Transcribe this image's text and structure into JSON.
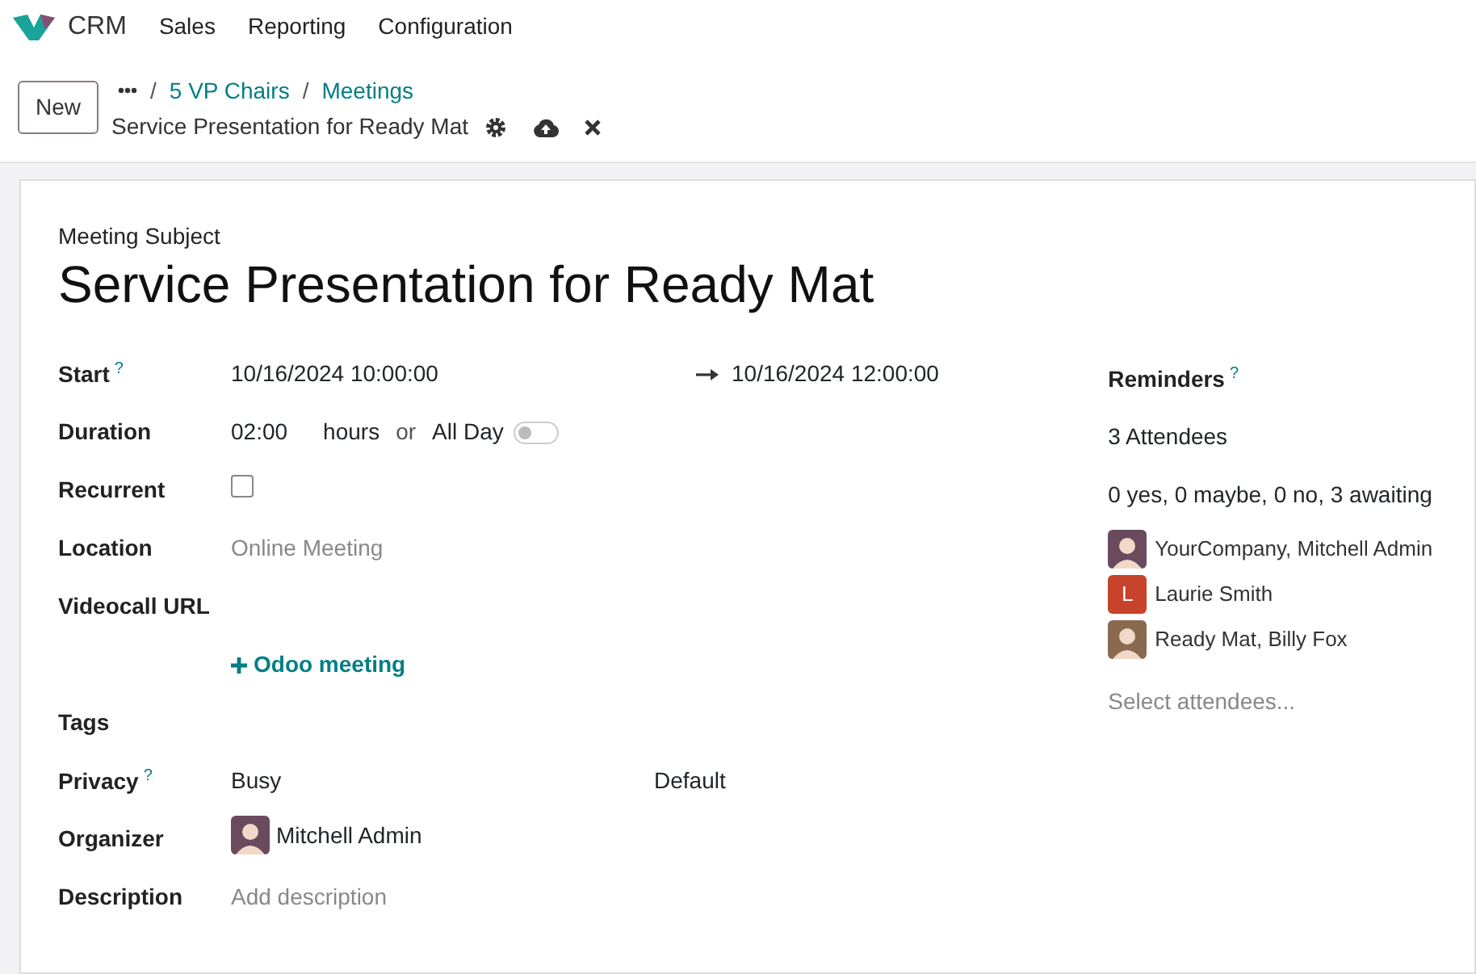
{
  "app": {
    "name": "CRM"
  },
  "menu": [
    "Sales",
    "Reporting",
    "Configuration"
  ],
  "new_button": "New",
  "breadcrumbs": [
    "5 VP Chairs",
    "Meetings"
  ],
  "breadcrumb_separator": "/",
  "record_title": "Service Presentation for Ready Mat",
  "form": {
    "subject_label": "Meeting Subject",
    "subject": "Service Presentation for Ready Mat",
    "fields": [
      {
        "kind": "range",
        "label": "Start",
        "help": "?",
        "value": "10/16/2024 10:00:00",
        "end": "10/16/2024 12:00:00"
      },
      {
        "kind": "duration",
        "label": "Duration",
        "value": "02:00",
        "unit": "hours",
        "joiner": "or",
        "toggle_label": "All Day",
        "on": false
      },
      {
        "kind": "checkbox",
        "label": "Recurrent",
        "checked": false
      },
      {
        "kind": "text",
        "label": "Location",
        "placeholder": "Online Meeting"
      },
      {
        "kind": "link",
        "label": "Videocall URL",
        "link": "Odoo meeting"
      },
      {
        "kind": "text",
        "label": "Tags"
      },
      {
        "kind": "pair",
        "label": "Privacy",
        "help": "?",
        "value": "Busy",
        "value_2": "Default"
      },
      {
        "kind": "user",
        "label": "Organizer",
        "value": "Mitchell Admin"
      },
      {
        "kind": "text",
        "label": "Description",
        "placeholder": "Add description"
      }
    ],
    "reminders": {
      "label": "Reminders",
      "help": "?"
    },
    "attendees_count": "3 Attendees",
    "attendance_summary": "0 yes, 0 maybe, 0 no, 3 awaiting",
    "attendees": [
      {
        "kind": "photo",
        "name": "YourCompany, Mitchell Admin",
        "color": "#6b4a5e"
      },
      {
        "kind": "initial",
        "initial": "L",
        "name": "Laurie Smith",
        "color": "#c8432b"
      },
      {
        "kind": "photo",
        "name": "Ready Mat, Billy Fox",
        "color": "#8a6a4e"
      }
    ],
    "attendee_placeholder": "Select attendees..."
  }
}
